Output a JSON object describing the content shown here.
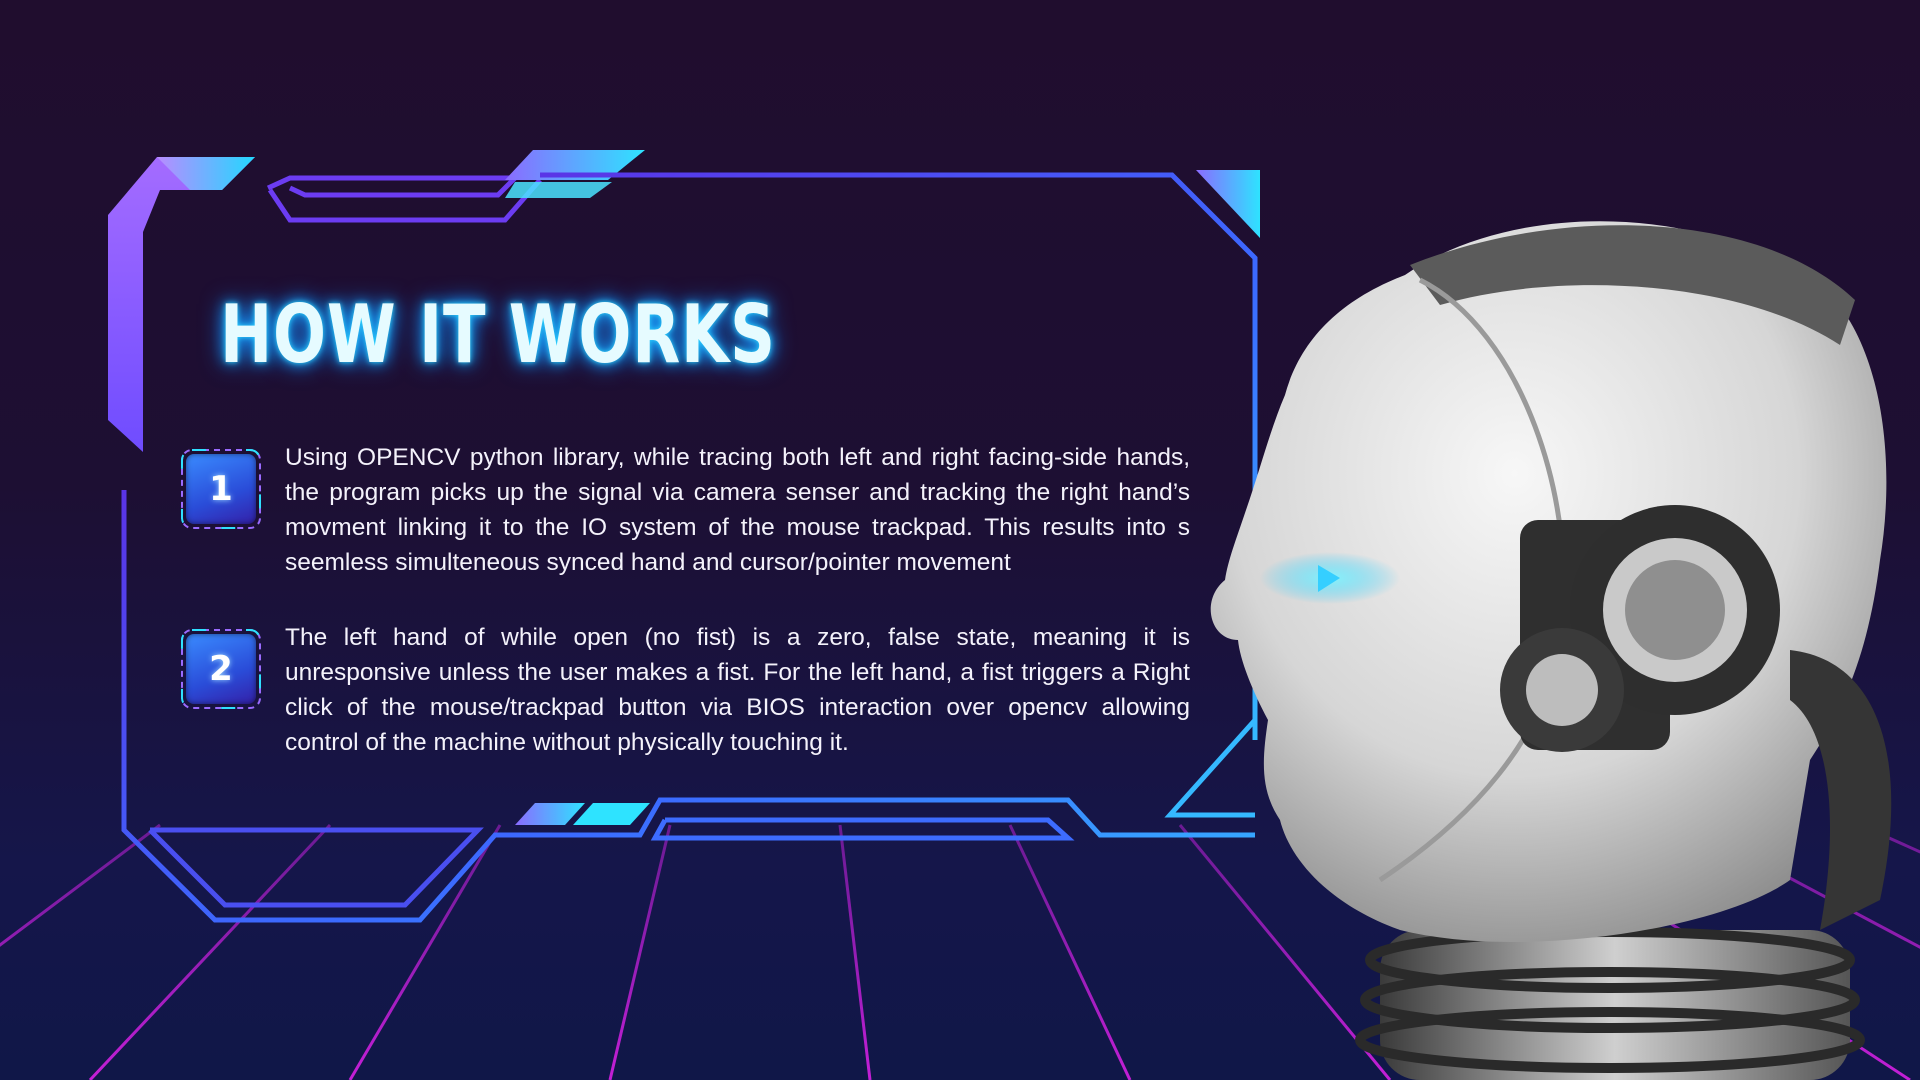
{
  "slide": {
    "title": "HOW IT WORKS",
    "steps": [
      {
        "number": "1",
        "text": "Using OPENCV python library, while tracing both left and right facing-side  hands, the program picks up the signal via camera senser and tracking the right hand’s movment linking it to the IO system of the mouse trackpad. This results into s seemless simulteneous synced hand and cursor/pointer movement"
      },
      {
        "number": "2",
        "text": "The left hand of while open (no fist) is a zero, false state, meaning it is unresponsive unless the user makes a fist.  For the left hand, a fist triggers a Right click of the mouse/trackpad button via BIOS interaction over opencv allowing control of the machine without physically touching it."
      }
    ]
  },
  "colors": {
    "background_top": "#200d2e",
    "background_bottom": "#101748",
    "frame_blue": "#3d6cff",
    "frame_cyan": "#27d9ff",
    "frame_purple": "#8a5cff",
    "grid_magenta": "#a21cc4",
    "title_glow": "#2fd8ff"
  },
  "decor": {
    "robot_head": "robot-head-illustration",
    "floor": "neon-grid-floor"
  }
}
